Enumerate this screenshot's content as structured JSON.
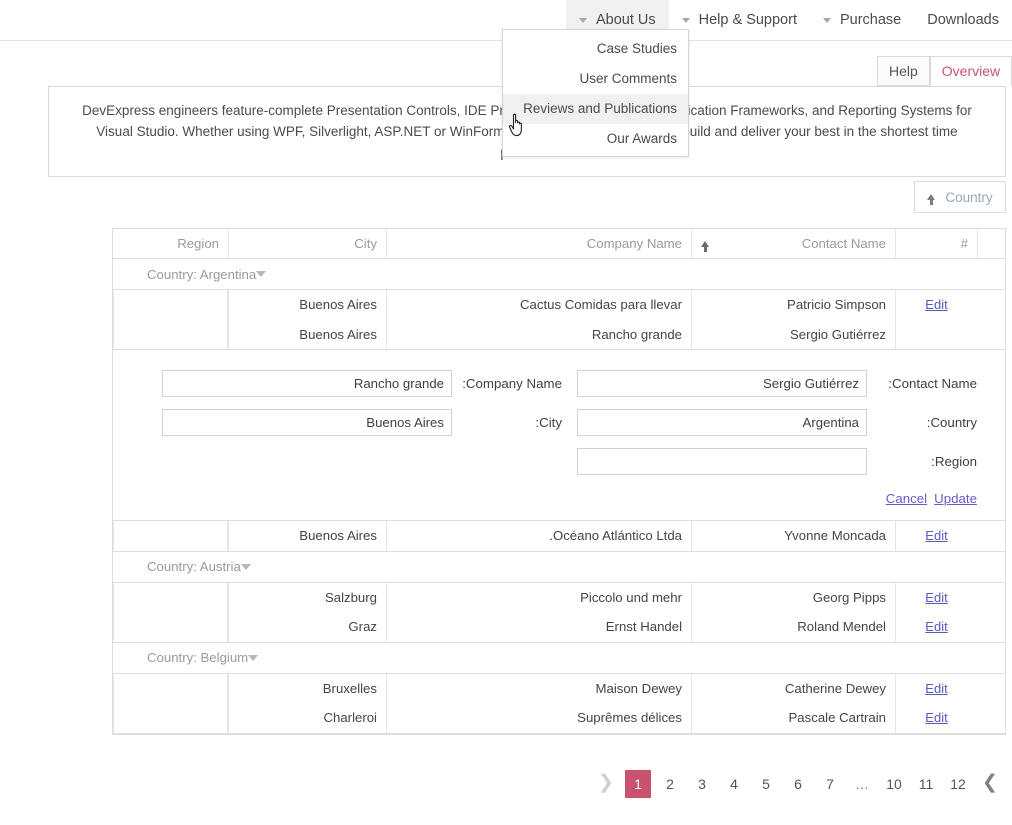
{
  "topnav": {
    "items": [
      {
        "label": "Downloads",
        "has_caret": false,
        "hovered": false
      },
      {
        "label": "Purchase",
        "has_caret": true,
        "hovered": false
      },
      {
        "label": "Help & Support",
        "has_caret": true,
        "hovered": false
      },
      {
        "label": "About Us",
        "has_caret": true,
        "hovered": true
      }
    ]
  },
  "dropdown": {
    "items": [
      {
        "label": "Case Studies",
        "active": false
      },
      {
        "label": "User Comments",
        "active": false
      },
      {
        "label": "Reviews and Publications",
        "active": true
      },
      {
        "label": "Our Awards",
        "active": false
      }
    ]
  },
  "tabs": [
    {
      "label": "Overview",
      "active": true
    },
    {
      "label": "Help",
      "active": false
    }
  ],
  "banner": {
    "text": "DevExpress engineers feature-complete Presentation Controls, IDE Productivity Tools, Business Application Frameworks, and Reporting Systems for Visual Studio. Whether using WPF, Silverlight, ASP.NET or WinForms, DevExpress tools help you build and deliver your best in the shortest time possible."
  },
  "sort_chip": {
    "label": "Country",
    "icon": "arrow-up-icon",
    "direction": "ascending"
  },
  "grid": {
    "columns": [
      {
        "key": "region",
        "label": "Region"
      },
      {
        "key": "city",
        "label": "City"
      },
      {
        "key": "company",
        "label": "Company Name"
      },
      {
        "key": "contact",
        "label": "Contact Name",
        "sorted": true,
        "sort_icon": "sort-asc-icon"
      },
      {
        "key": "num",
        "label": "#"
      }
    ],
    "groups": [
      {
        "label": "Country: Argentina",
        "rows_before_edit": [
          {
            "region": "",
            "city": "Buenos Aires",
            "company": "Cactus Comidas para llevar",
            "contact": "Patricio Simpson",
            "action": "Edit"
          },
          {
            "region": "",
            "city": "Buenos Aires",
            "company": "Rancho grande",
            "contact": "Sergio Gutiérrez",
            "action": ""
          }
        ],
        "rows_after_edit": [
          {
            "region": "",
            "city": "Buenos Aires",
            "company": "Océano Atlántico Ltda.",
            "contact": "Yvonne Moncada",
            "action": "Edit"
          }
        ]
      },
      {
        "label": "Country: Austria",
        "rows": [
          {
            "region": "",
            "city": "Salzburg",
            "company": "Piccolo und mehr",
            "contact": "Georg Pipps",
            "action": "Edit"
          },
          {
            "region": "",
            "city": "Graz",
            "company": "Ernst Handel",
            "contact": "Roland Mendel",
            "action": "Edit"
          }
        ]
      },
      {
        "label": "Country: Belgium",
        "rows": [
          {
            "region": "",
            "city": "Bruxelles",
            "company": "Maison Dewey",
            "contact": "Catherine Dewey",
            "action": "Edit"
          },
          {
            "region": "",
            "city": "Charleroi",
            "company": "Suprêmes délices",
            "contact": "Pascale Cartrain",
            "action": "Edit"
          }
        ]
      }
    ]
  },
  "edit_form": {
    "fields": [
      {
        "label": "Company Name:",
        "value": "Rancho grande"
      },
      {
        "label": "Contact Name:",
        "value": "Sergio Gutiérrez"
      },
      {
        "label": "City:",
        "value": "Buenos Aires"
      },
      {
        "label": "Country:",
        "value": "Argentina"
      },
      {
        "label": "Region:",
        "value": ""
      }
    ],
    "update_label": "Update",
    "cancel_label": "Cancel"
  },
  "pager": {
    "prev_icon": "❮",
    "next_icon": "❯",
    "pages": [
      "12",
      "11",
      "10",
      "…",
      "7",
      "6",
      "5",
      "4",
      "3",
      "2",
      "1"
    ],
    "current": "1"
  },
  "colors": {
    "accent": "#c9536e",
    "link": "#5a5ab8",
    "muted": "#9a9a9a",
    "border": "#dedede"
  }
}
